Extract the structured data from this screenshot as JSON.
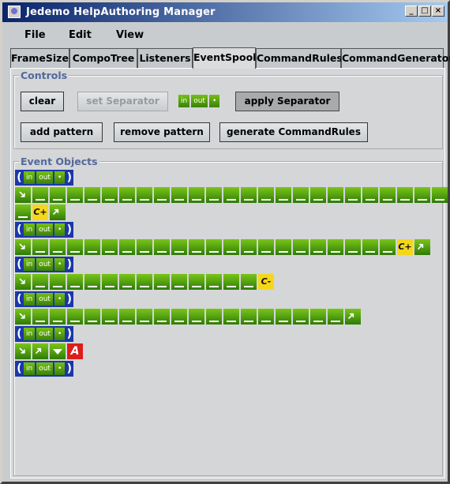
{
  "window": {
    "title": "Jedemo HelpAuthoring Manager",
    "min": "_",
    "max": "□",
    "close": "×"
  },
  "menu": [
    "File",
    "Edit",
    "View"
  ],
  "tabs": [
    "FrameSize",
    "CompoTree",
    "Listeners",
    "EventSpool",
    "CommandRules",
    "CommandGenerator"
  ],
  "controls": {
    "title": "Controls",
    "clear": "clear",
    "set_separator": "set Separator",
    "apply_separator": "apply Separator",
    "add_pattern": "add pattern",
    "remove_pattern": "remove pattern",
    "generate": "generate CommandRules"
  },
  "separator": {
    "open": "(",
    "in": "in",
    "out": "out",
    "dot": "•",
    "close": ")"
  },
  "events": {
    "title": "Event Objects",
    "rows": [
      [
        "sep"
      ],
      [
        "se",
        "d",
        "d",
        "d",
        "d",
        "d",
        "d",
        "d",
        "d",
        "d",
        "d",
        "d",
        "d",
        "d",
        "d",
        "d",
        "d",
        "d",
        "d",
        "d",
        "d",
        "d",
        "d",
        "d",
        "d"
      ],
      [
        "d",
        "C+",
        "ne"
      ],
      [
        "sep"
      ],
      [
        "se",
        "d",
        "d",
        "d",
        "d",
        "d",
        "d",
        "d",
        "d",
        "d",
        "d",
        "d",
        "d",
        "d",
        "d",
        "d",
        "d",
        "d",
        "d",
        "d",
        "d",
        "d",
        "C+",
        "ne"
      ],
      [
        "sep"
      ],
      [
        "se",
        "d",
        "d",
        "d",
        "d",
        "d",
        "d",
        "d",
        "d",
        "d",
        "d",
        "d",
        "d",
        "d",
        "C-"
      ],
      [
        "sep"
      ],
      [
        "se",
        "d",
        "d",
        "d",
        "d",
        "d",
        "d",
        "d",
        "d",
        "d",
        "d",
        "d",
        "d",
        "d",
        "d",
        "d",
        "d",
        "d",
        "d",
        "ne"
      ],
      [
        "sep"
      ],
      [
        "se",
        "ne",
        "dn",
        "A"
      ],
      [
        "sep"
      ]
    ]
  }
}
